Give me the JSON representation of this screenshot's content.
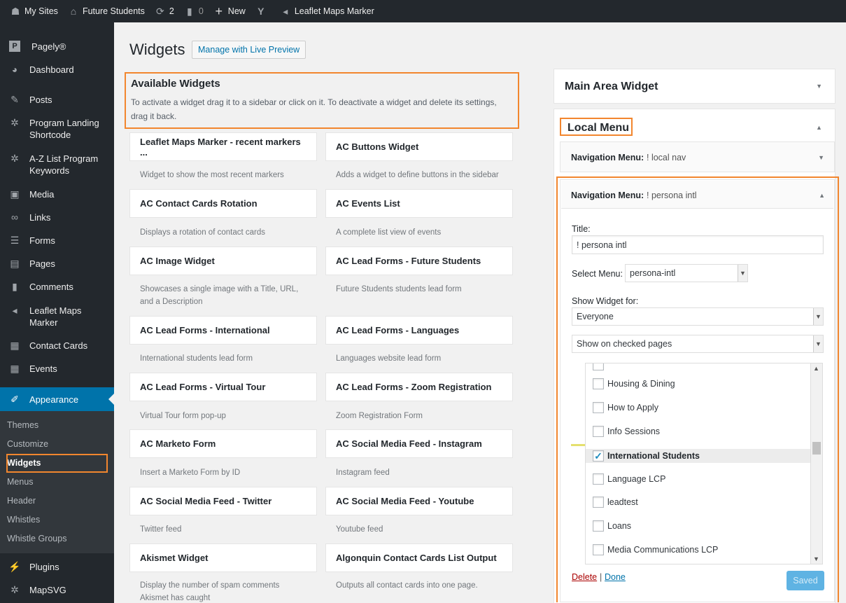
{
  "adminbar": {
    "items": [
      {
        "icon": "my-sites-icon",
        "glyph": "⌂",
        "label": "My Sites"
      },
      {
        "icon": "home-icon",
        "glyph": "⌂",
        "label": "Future Students"
      },
      {
        "icon": "updates-icon",
        "glyph": "⟳",
        "label": "2"
      },
      {
        "icon": "comments-icon",
        "glyph": "▪",
        "label": "0"
      },
      {
        "icon": "plus-icon",
        "glyph": "+",
        "label": "New"
      },
      {
        "icon": "yoast-icon",
        "glyph": "Y",
        "label": ""
      },
      {
        "icon": "map-marker-icon",
        "glyph": "◉",
        "label": "Leaflet Maps Marker"
      }
    ]
  },
  "sidebar": {
    "items": [
      {
        "name": "pagely",
        "label": "Pagely®"
      },
      {
        "name": "dashboard",
        "label": "Dashboard"
      },
      {
        "name": "posts",
        "label": "Posts"
      },
      {
        "name": "program-landing-shortcode",
        "label": "Program Landing Shortcode"
      },
      {
        "name": "az-list",
        "label": "A-Z List Program Keywords"
      },
      {
        "name": "media",
        "label": "Media"
      },
      {
        "name": "links",
        "label": "Links"
      },
      {
        "name": "forms",
        "label": "Forms"
      },
      {
        "name": "pages",
        "label": "Pages"
      },
      {
        "name": "comments",
        "label": "Comments"
      },
      {
        "name": "leaflet-maps-marker",
        "label": "Leaflet Maps Marker"
      },
      {
        "name": "contact-cards",
        "label": "Contact Cards"
      },
      {
        "name": "events",
        "label": "Events"
      },
      {
        "name": "appearance",
        "label": "Appearance"
      },
      {
        "name": "plugins",
        "label": "Plugins"
      },
      {
        "name": "mapsvg",
        "label": "MapSVG"
      }
    ],
    "submenu": [
      "Themes",
      "Customize",
      "Widgets",
      "Menus",
      "Header",
      "Whistles",
      "Whistle Groups"
    ]
  },
  "page": {
    "title": "Widgets",
    "live_preview_label": "Manage with Live Preview"
  },
  "available": {
    "heading": "Available Widgets",
    "description": "To activate a widget drag it to a sidebar or click on it. To deactivate a widget and delete its settings, drag it back."
  },
  "widgets": [
    {
      "title": "Leaflet Maps Marker - recent markers ...",
      "desc": "Widget to show the most recent markers"
    },
    {
      "title": "AC Buttons Widget",
      "desc": "Adds a widget to define buttons in the sidebar"
    },
    {
      "title": "AC Contact Cards Rotation",
      "desc": "Displays a rotation of contact cards"
    },
    {
      "title": "AC Events List",
      "desc": "A complete list view of events"
    },
    {
      "title": "AC Image Widget",
      "desc": "Showcases a single image with a Title, URL, and a Description"
    },
    {
      "title": "AC Lead Forms - Future Students",
      "desc": "Future Students students lead form"
    },
    {
      "title": "AC Lead Forms - International",
      "desc": "International students lead form"
    },
    {
      "title": "AC Lead Forms - Languages",
      "desc": "Languages website lead form"
    },
    {
      "title": "AC Lead Forms - Virtual Tour",
      "desc": "Virtual Tour form pop-up"
    },
    {
      "title": "AC Lead Forms - Zoom Registration",
      "desc": "Zoom Registration Form"
    },
    {
      "title": "AC Marketo Form",
      "desc": "Insert a Marketo Form by ID"
    },
    {
      "title": "AC Social Media Feed - Instagram",
      "desc": "Instagram feed"
    },
    {
      "title": "AC Social Media Feed - Twitter",
      "desc": "Twitter feed"
    },
    {
      "title": "AC Social Media Feed - Youtube",
      "desc": "Youtube feed"
    },
    {
      "title": "Akismet Widget",
      "desc": "Display the number of spam comments Akismet has caught"
    },
    {
      "title": "Algonquin Contact Cards List Output",
      "desc": "Outputs all contact cards into one page."
    }
  ],
  "areas": {
    "main_area_title": "Main Area Widget",
    "local_menu_title": "Local Menu",
    "nav_local": {
      "prefix": "Navigation Menu:",
      "name": "! local nav"
    },
    "nav_persona": {
      "prefix": "Navigation Menu:",
      "name": "! persona intl"
    }
  },
  "form": {
    "title_label": "Title:",
    "title_value": "! persona intl",
    "select_menu_label": "Select Menu:",
    "select_menu_value": "persona-intl",
    "show_widget_label": "Show Widget for:",
    "show_widget_value": "Everyone",
    "pages_mode_value": "Show on checked pages",
    "checklist": [
      {
        "label": "Housing & Dining",
        "checked": false
      },
      {
        "label": "How to Apply",
        "checked": false
      },
      {
        "label": "Info Sessions",
        "checked": false
      },
      {
        "label": "International Students",
        "checked": true
      },
      {
        "label": "Language LCP",
        "checked": false
      },
      {
        "label": "leadtest",
        "checked": false
      },
      {
        "label": "Loans",
        "checked": false
      },
      {
        "label": "Media Communications LCP",
        "checked": false
      }
    ],
    "delete_label": "Delete",
    "separator": "|",
    "done_label": "Done",
    "saved_label": "Saved"
  },
  "colors": {
    "highlight": "#f2862e",
    "admin_dark": "#23282d",
    "accent": "#0073aa"
  }
}
